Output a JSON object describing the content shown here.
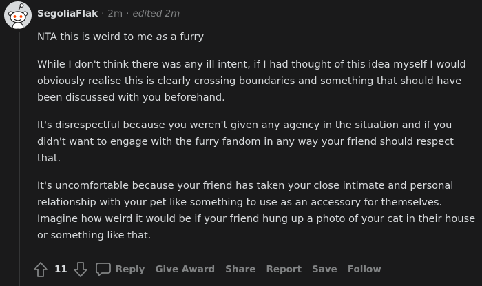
{
  "comment": {
    "username": "SegoliaFlak",
    "time_ago": "2m",
    "edited": "edited 2m",
    "separator": "·",
    "body": {
      "p1_a": "NTA this is weird to me ",
      "p1_em": "as",
      "p1_b": " a furry",
      "p2": "While I don't think there was any ill intent, if I had thought of this idea myself I would obviously realise this is clearly crossing boundaries and something that should have been discussed with you beforehand.",
      "p3": "It's disrespectful because you weren't given any agency in the situation and if you didn't want to engage with the furry fandom in any way your friend should respect that.",
      "p4": "It's uncomfortable because your friend has taken your close intimate and personal relationship with your pet like something to use as an accessory for themselves. Imagine how weird it would be if your friend hung up a photo of your cat in their house or something like that."
    },
    "votes": "11",
    "actions": {
      "reply": "Reply",
      "give_award": "Give Award",
      "share": "Share",
      "report": "Report",
      "save": "Save",
      "follow": "Follow"
    },
    "icons": {
      "avatar": "reddit-snoo-avatar",
      "upvote": "upvote-arrow-icon",
      "downvote": "downvote-arrow-icon",
      "reply": "speech-bubble-icon"
    },
    "colors": {
      "background": "#1a1a1b",
      "text": "#d7dadc",
      "muted": "#818384",
      "thread_line": "#343536",
      "avatar_bg": "#d7dadc"
    }
  }
}
